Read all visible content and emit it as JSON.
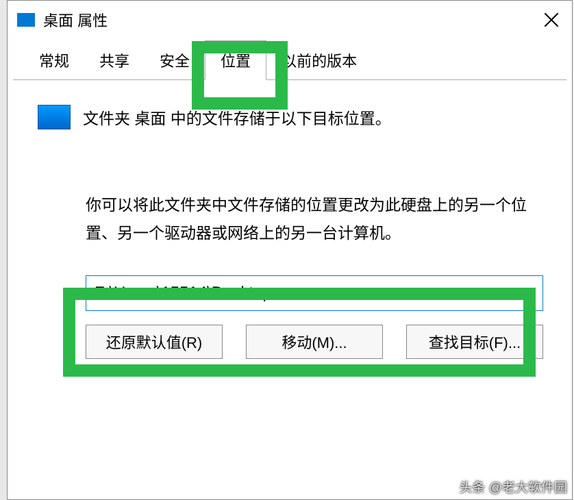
{
  "titlebar": {
    "title": "桌面 属性"
  },
  "tabs": {
    "general": "常规",
    "sharing": "共享",
    "security": "安全",
    "location": "位置",
    "previous": "以前的版本"
  },
  "content": {
    "desc": "文件夹 桌面 中的文件存储于以下目标位置。",
    "info": "你可以将此文件夹中文件存储的位置更改为此硬盘上的另一个位置、另一个驱动器或网络上的另一台计算机。",
    "path": "F:\\Users\\15514\\Desktop"
  },
  "buttons": {
    "restore": "还原默认值(R)",
    "move": "移动(M)...",
    "find": "查找目标(F)..."
  },
  "watermark": "头条 @老大软件园"
}
